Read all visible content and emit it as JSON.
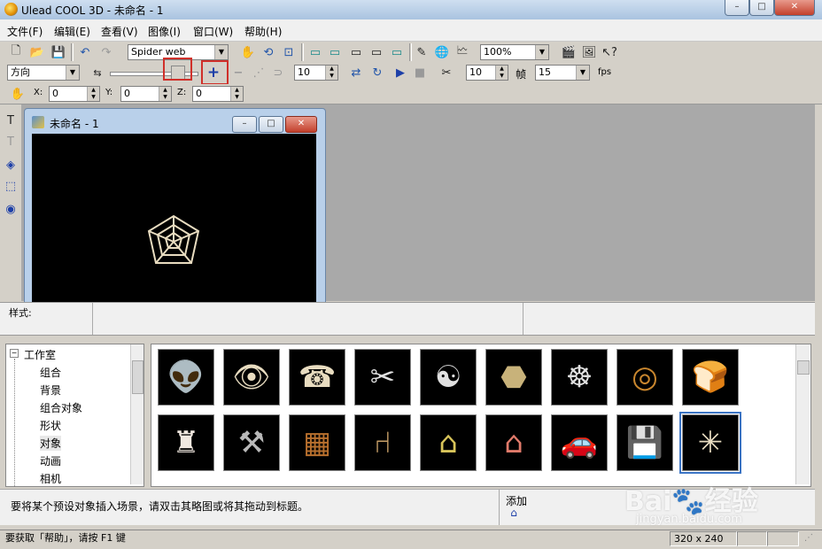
{
  "window": {
    "title": "Ulead COOL 3D - 未命名 - 1",
    "min": "–",
    "max": "□",
    "close": "✕"
  },
  "menu": [
    "文件(F)",
    "编辑(E)",
    "查看(V)",
    "图像(I)",
    "窗口(W)",
    "帮助(H)"
  ],
  "toolbar1": {
    "font_combo": "Spider web",
    "zoom_combo": "100%"
  },
  "toolbar2": {
    "direction_combo": "方向",
    "frames_value": "10",
    "fps_value1": "10",
    "frame_label": "帧",
    "fps_value2": "15",
    "fps_label": "fps"
  },
  "toolbar3": {
    "x_label": "X:",
    "x_value": "0",
    "y_label": "Y:",
    "y_value": "0",
    "z_label": "Z:",
    "z_value": "0"
  },
  "document": {
    "title": "未命名 - 1",
    "min": "–",
    "max": "□",
    "close": "✕"
  },
  "stylebar": {
    "label": "样式:"
  },
  "tree": {
    "root": "工作室",
    "items": [
      "组合",
      "背景",
      "组合对象",
      "形状",
      "对象",
      "动画",
      "相机"
    ]
  },
  "thumbnails": {
    "row1": [
      "alien",
      "eye",
      "telephone",
      "scissors",
      "yin-yang",
      "coin",
      "steering-wheel",
      "donut",
      "bread"
    ],
    "row2": [
      "bowling-pin",
      "hammer",
      "box",
      "chair",
      "house",
      "barn",
      "car",
      "floppy-disk",
      "spider-web"
    ]
  },
  "hint": {
    "text": "要将某个预设对象插入场景，请双击其略图或将其拖动到标题。",
    "add_label": "添加"
  },
  "status": {
    "help": "要获取「帮助」，请按 F1 键",
    "size": "320 x 240"
  },
  "watermark": {
    "brand": "Bai",
    "brand2": "经验",
    "url": "jingyan.baidu.com"
  },
  "colors": {
    "highlight_box": "#d0302a",
    "canvas": "#000000",
    "workspace": "#a9a9a9",
    "selection": "#3b74c4"
  }
}
